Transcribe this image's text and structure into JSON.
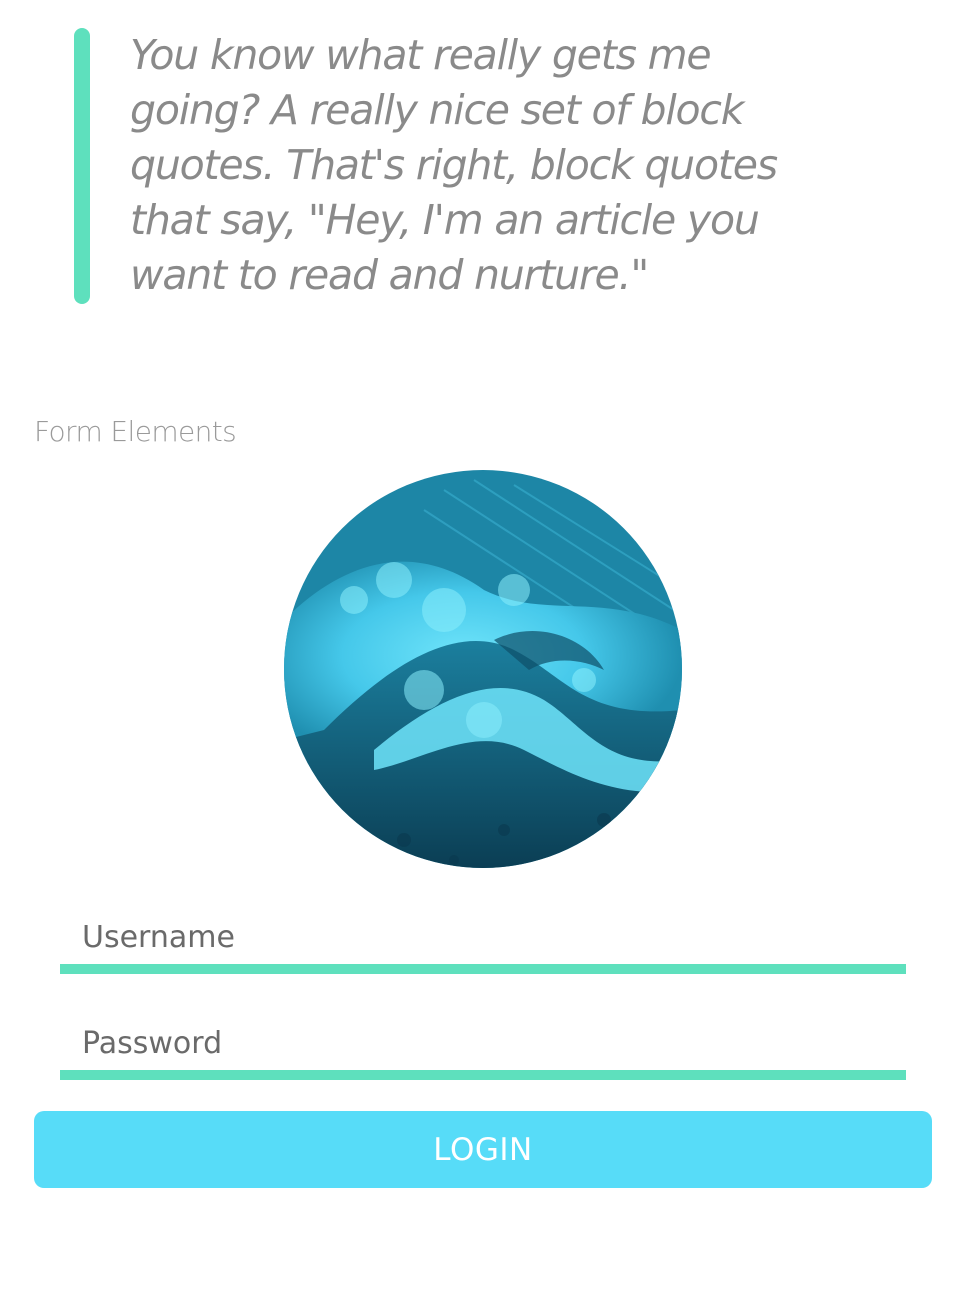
{
  "quote": {
    "text": "You know what really gets me going? A really nice set of block quotes. That's right, block quotes that say, \"Hey, I'm an article you want to read and nurture.\"",
    "accent_color": "#5ee0bd"
  },
  "form": {
    "section_label": "Form Elements",
    "avatar_icon": "ocean-wave-image",
    "username_placeholder": "Username",
    "password_placeholder": "Password",
    "login_label": "LOGIN",
    "input_underline_color": "#5ee0bd",
    "button_color": "#57dcf8"
  }
}
